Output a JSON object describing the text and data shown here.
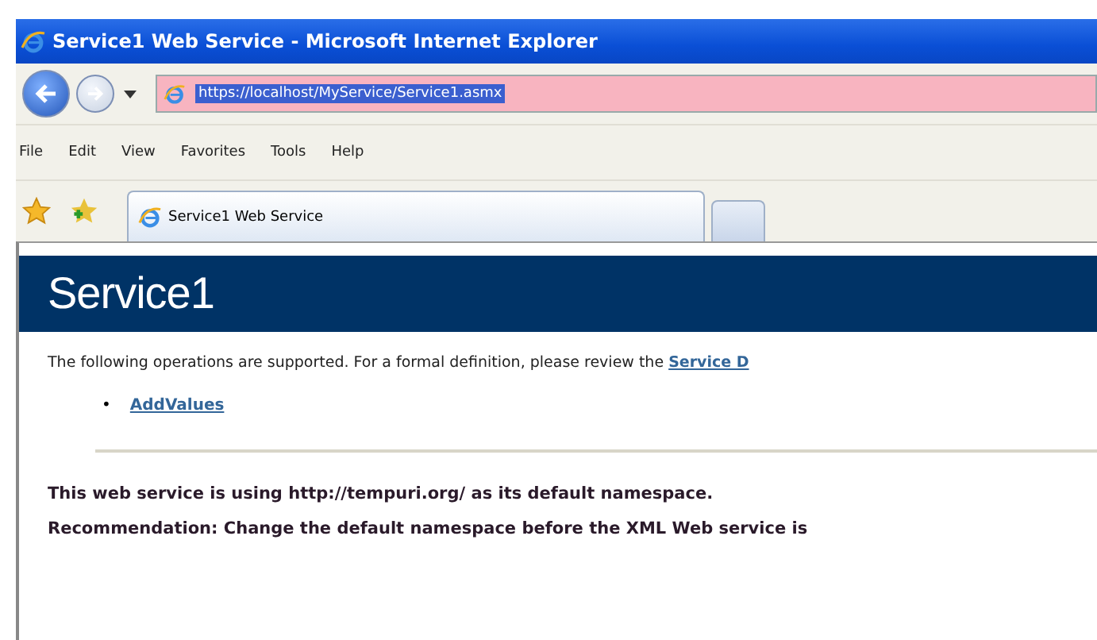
{
  "window": {
    "title": "Service1 Web Service - Microsoft Internet Explorer"
  },
  "address_bar": {
    "value": "https://localhost/MyService/Service1.asmx",
    "selected": true
  },
  "menu": [
    "File",
    "Edit",
    "View",
    "Favorites",
    "Tools",
    "Help"
  ],
  "tabs": [
    {
      "kind": "page",
      "label": "Service1 Web Service",
      "selected": true
    },
    {
      "kind": "new",
      "selected": false
    }
  ],
  "page": {
    "heading": "Service1",
    "intro": "The following operations are supported. For a formal definition, please review the",
    "intro_link": "Service D",
    "operations": [
      {
        "bullet": "•",
        "name": "AddValues"
      }
    ],
    "namespace_note": "This web service is using http://tempuri.org/ as its default namespace.",
    "recommendation": "Recommendation: Change the default namespace before the XML Web service is"
  }
}
